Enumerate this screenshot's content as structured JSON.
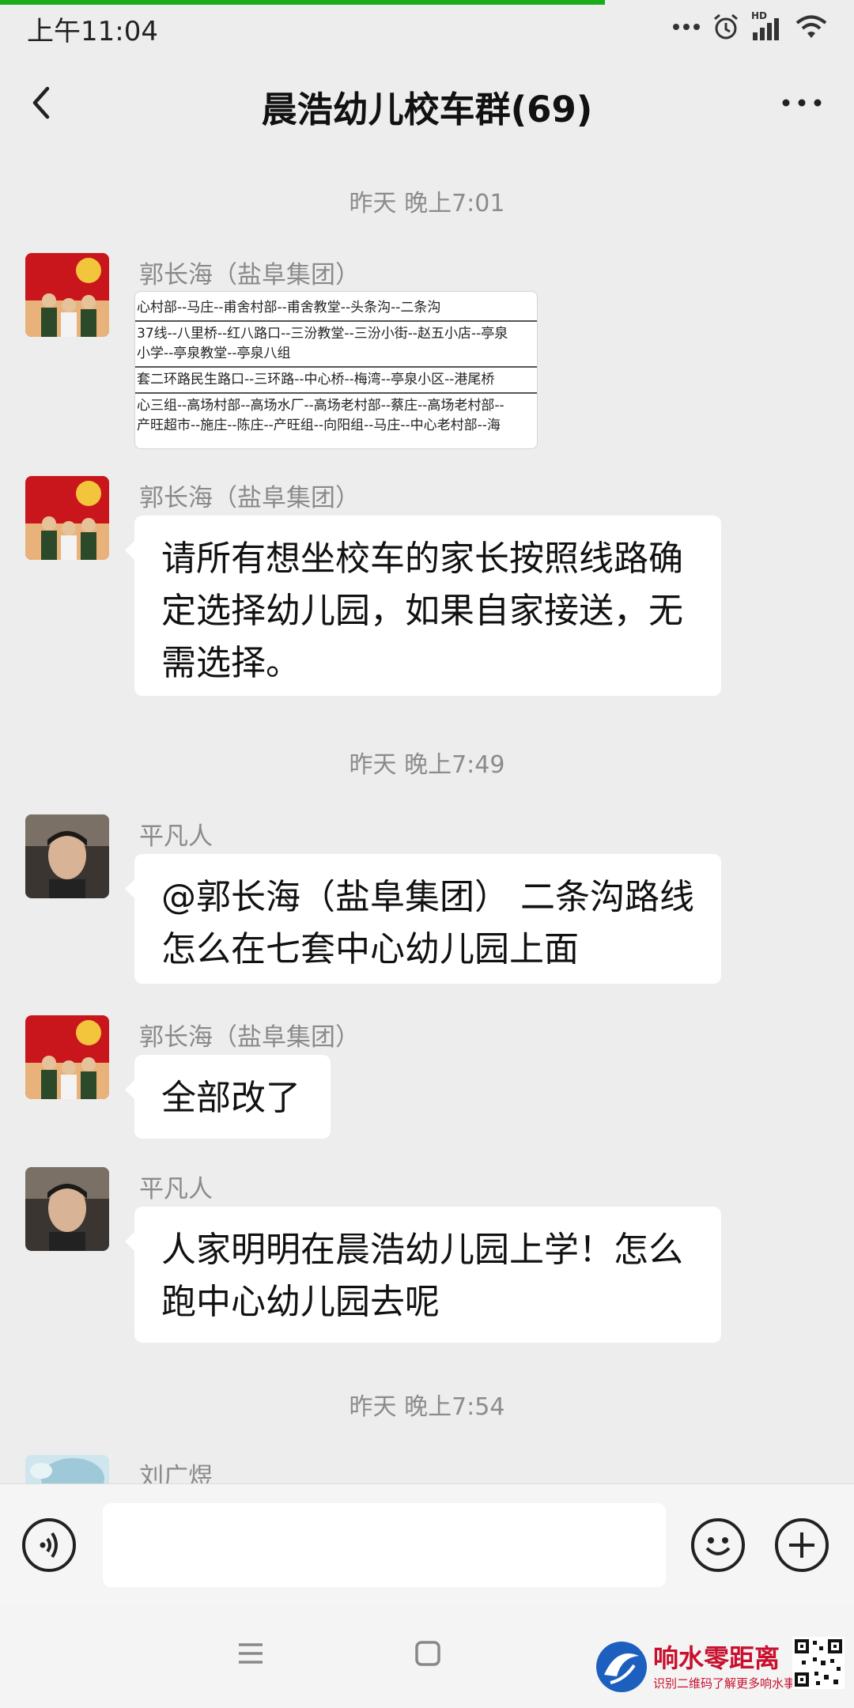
{
  "status": {
    "time": "上午11:04",
    "network_badge": "HD"
  },
  "header": {
    "title": "晨浩幼儿校车群(69)"
  },
  "messages": [
    {
      "type": "time",
      "text": "昨天 晚上7:01"
    },
    {
      "type": "image",
      "sender": "郭长海（盐阜集团）",
      "image_lines": [
        "心村部--马庄--甫舍村部--甫舍教堂--头条沟--二条沟",
        "37线--八里桥--红八路口--三汾教堂--三汾小街--赵五小店--亭泉",
        "小学--亭泉教堂--亭泉八组",
        "套二环路民生路口--三环路--中心桥--梅湾--亭泉小区--港尾桥",
        "心三组--高场村部--高场水厂--高场老村部--蔡庄--高场老村部--",
        "产旺超市--施庄--陈庄--产旺组--向阳组--马庄--中心老村部--海"
      ]
    },
    {
      "type": "text",
      "sender": "郭长海（盐阜集团）",
      "text": "请所有想坐校车的家长按照线路确定选择幼儿园，如果自家接送，无需选择。"
    },
    {
      "type": "time",
      "text": "昨天 晚上7:49"
    },
    {
      "type": "text",
      "sender": "平凡人",
      "text": "@郭长海（盐阜集团） 二条沟路线怎么在七套中心幼儿园上面"
    },
    {
      "type": "text",
      "sender": "郭长海（盐阜集团）",
      "text": "全部改了"
    },
    {
      "type": "text",
      "sender": "平凡人",
      "text": "人家明明在晨浩幼儿园上学！怎么跑中心幼儿园去呢"
    },
    {
      "type": "time",
      "text": "昨天 晚上7:54"
    },
    {
      "type": "partial",
      "sender": "刘广煜"
    }
  ],
  "watermark": {
    "title": "响水零距离",
    "subtitle": "识别二维码了解更多响水事"
  },
  "colors": {
    "background": "#ededed",
    "bubble": "#ffffff",
    "progress": "#1aad19",
    "watermark": "#c8102e"
  },
  "icons": [
    "back-icon",
    "more-icon",
    "voice-icon",
    "emoji-icon",
    "add-icon",
    "menu-icon",
    "home-icon"
  ]
}
